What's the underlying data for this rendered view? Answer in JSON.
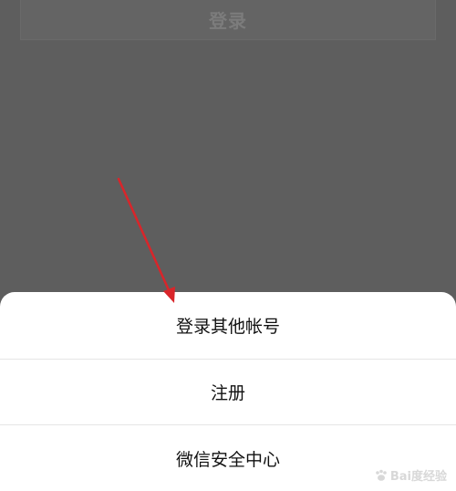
{
  "background": {
    "login_button_label": "登录"
  },
  "action_sheet": {
    "items": [
      {
        "label": "登录其他帐号"
      },
      {
        "label": "注册"
      },
      {
        "label": "微信安全中心"
      }
    ]
  },
  "annotation": {
    "arrow_color": "#d9252a",
    "arrow_icon": "arrow-icon"
  },
  "watermark": {
    "text": "Bai度经验",
    "icon": "paw-icon"
  },
  "colors": {
    "overlay": "#5e5e5e",
    "sheet": "#ffffff",
    "divider": "#e6e6e6"
  }
}
